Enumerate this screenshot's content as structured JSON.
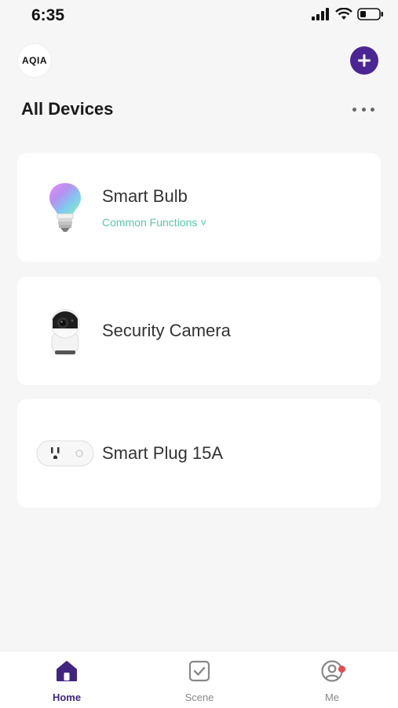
{
  "status_bar": {
    "time": "6:35"
  },
  "header": {
    "logo_text": "AQIA",
    "page_title": "All Devices"
  },
  "devices": [
    {
      "name": "Smart Bulb",
      "subtitle": "Common Functions ˅",
      "icon": "bulb-icon"
    },
    {
      "name": "Security Camera",
      "icon": "camera-icon"
    },
    {
      "name": "Smart Plug 15A",
      "icon": "plug-icon"
    }
  ],
  "tabs": [
    {
      "label": "Home",
      "icon": "home-icon",
      "active": true
    },
    {
      "label": "Scene",
      "icon": "scene-icon",
      "active": false
    },
    {
      "label": "Me",
      "icon": "profile-icon",
      "active": false,
      "badge": true
    }
  ],
  "colors": {
    "accent": "#4b2594",
    "accent_text": "#3f2580",
    "link": "#5cc6ad",
    "badge": "#e74c4c",
    "background": "#f6f6f7"
  }
}
